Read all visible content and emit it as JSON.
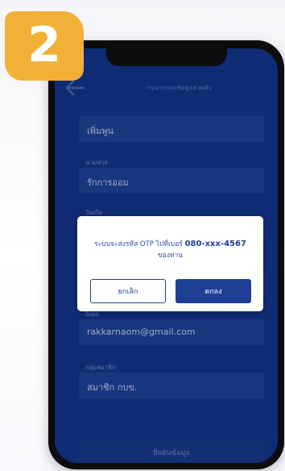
{
  "step": {
    "number": "2"
  },
  "statusbar": {
    "time": "",
    "right": ""
  },
  "appbar": {
    "title": "กรุณากรอกข้อมูลส่วนตัว"
  },
  "form": {
    "field1": {
      "label": "",
      "value": "เพิ่มพูน"
    },
    "field2": {
      "label": "นามสกุล",
      "value": "รักการออม"
    },
    "field3": {
      "label": "วันเกิด",
      "value": ""
    },
    "field4": {
      "label": "",
      "value": ""
    },
    "field5": {
      "label": "อีเมล",
      "value": "rakkarnaom@gmail.com"
    },
    "field6": {
      "label": "กลุ่มสมาชิก",
      "value": "สมาชิก กบข."
    }
  },
  "submit": {
    "label": "ยืนยันข้อมูล"
  },
  "dialog": {
    "message_prefix": "ระบบจะส่งรหัส OTP ไปที่เบอร์",
    "phone": "080-xxx-4567",
    "message_suffix": "ของท่าน",
    "cancel_label": "ยกเลิก",
    "ok_label": "ตกลง"
  },
  "colors": {
    "badge": "#f3b037",
    "screen": "#112f7c",
    "field": "#1b3a86",
    "primary": "#1f3f94"
  },
  "icons": {
    "back": "arrow-left-icon"
  }
}
